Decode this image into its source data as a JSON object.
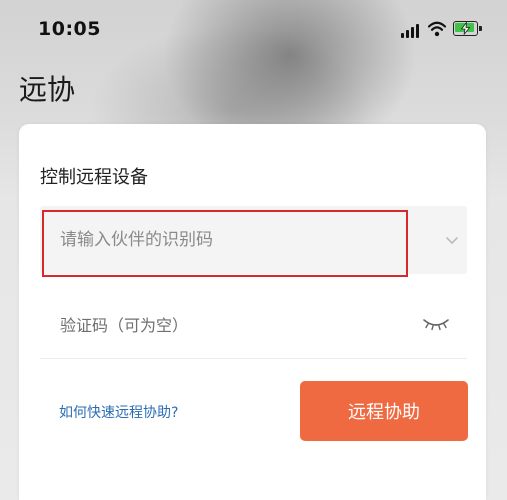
{
  "status_bar": {
    "time": "10:05"
  },
  "page": {
    "title": "远协"
  },
  "card": {
    "section_title": "控制远程设备",
    "partner_id": {
      "placeholder": "请输入伙伴的识别码",
      "value": ""
    },
    "verification_code": {
      "placeholder": "验证码（可为空）",
      "value": ""
    },
    "help_link": "如何快速远程协助?",
    "connect_button": "远程协助"
  },
  "colors": {
    "accent_button": "#f06a41",
    "link": "#2a6db5",
    "highlight_border": "#d9272e",
    "battery_fill": "#3ec24a"
  },
  "icons": {
    "signal": "cellular-signal-icon",
    "wifi": "wifi-icon",
    "battery": "battery-charging-icon",
    "dropdown": "chevron-down-icon",
    "password_visibility": "eye-closed-icon"
  }
}
